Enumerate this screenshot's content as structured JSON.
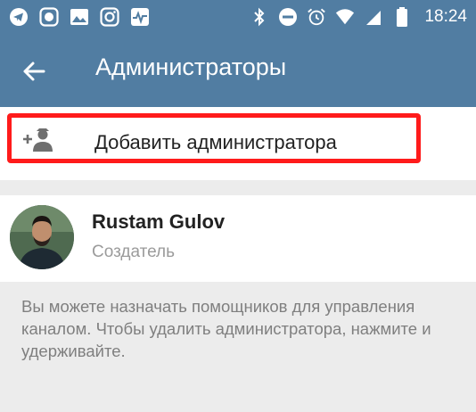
{
  "status_bar": {
    "time": "18:24",
    "left_icons": [
      "telegram-icon",
      "mi-icon",
      "gallery-icon",
      "instagram-icon",
      "activity-icon"
    ],
    "right_icons": [
      "bluetooth-icon",
      "dnd-icon",
      "alarm-icon",
      "wifi-icon",
      "signal-icon",
      "battery-icon"
    ]
  },
  "app_bar": {
    "title": "Администраторы",
    "back_icon": "arrow-back-icon"
  },
  "add_admin": {
    "label": "Добавить администратора",
    "icon": "add-person-icon",
    "highlight_color": "#ff1b1b"
  },
  "admins": [
    {
      "name": "Rustam Gulov",
      "role": "Создатель"
    }
  ],
  "info": {
    "text": "Вы можете назначать помощников для управления каналом. Чтобы удалить администратора, нажмите и удерживайте."
  },
  "colors": {
    "accent": "#517da2",
    "background": "#ececec"
  }
}
